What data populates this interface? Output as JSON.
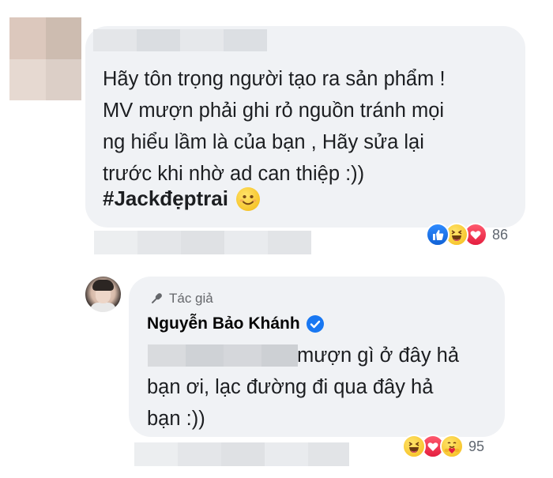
{
  "comment": {
    "lines": [
      "Hãy tôn trọng người tạo ra sản phẩm !",
      "MV mượn phải ghi rỏ nguồn tránh mọi",
      "ng hiểu lầm là của bạn , Hãy sửa lại",
      "trước khi nhờ ad can thiệp :))"
    ],
    "hashtag": "#Jackđẹptrai",
    "reaction_icons": [
      "like-icon",
      "haha-icon",
      "love-icon"
    ],
    "reaction_count": "86"
  },
  "reply": {
    "badge_label": "Tác giả",
    "author_name": "Nguyễn Bảo Khánh",
    "lines": [
      "mượn gì ở đây hả",
      "bạn ơi, lạc đường đi qua đây hả",
      "bạn :))"
    ],
    "reaction_icons": [
      "haha-icon",
      "love-icon",
      "care-icon"
    ],
    "reaction_count": "95"
  },
  "colors": {
    "bubble": "#f0f2f5",
    "text": "#1c1e21",
    "meta": "#65676b",
    "verified": "#1877f2",
    "like": "#1877f2",
    "love": "#e41e3f",
    "haha": "#f7c52c"
  }
}
